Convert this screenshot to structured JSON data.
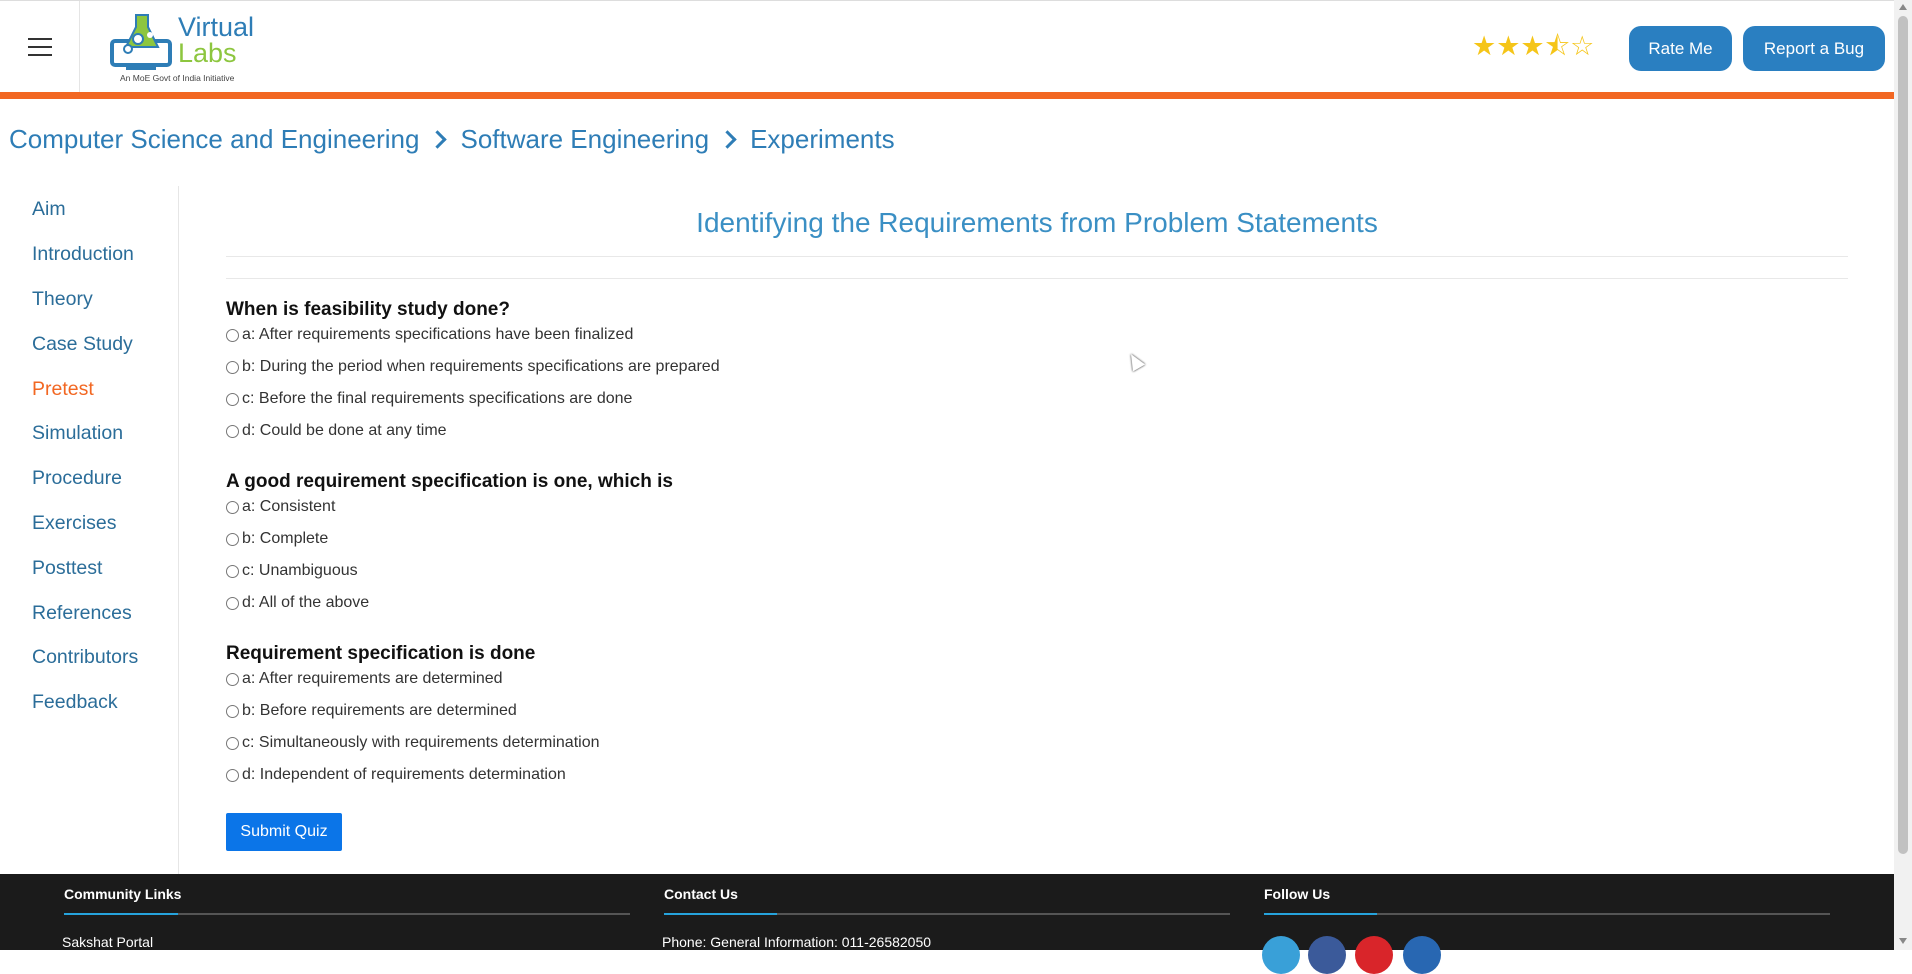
{
  "header": {
    "logo_line1": "Virtual",
    "logo_line2": "Labs",
    "logo_tagline": "An MoE Govt of India Initiative",
    "rating_stars": "★★★⯪☆",
    "rate_label": "Rate Me",
    "bug_label": "Report a Bug"
  },
  "breadcrumb": [
    "Computer Science and Engineering",
    "Software Engineering",
    "Experiments"
  ],
  "sidebar": {
    "items": [
      "Aim",
      "Introduction",
      "Theory",
      "Case Study",
      "Pretest",
      "Simulation",
      "Procedure",
      "Exercises",
      "Posttest",
      "References",
      "Contributors",
      "Feedback"
    ],
    "active": "Pretest"
  },
  "main": {
    "title": "Identifying the Requirements from Problem Statements",
    "questions": [
      {
        "text": "When is feasibility study done?",
        "options": [
          "a: After requirements specifications have been finalized",
          "b: During the period when requirements specifications are prepared",
          "c: Before the final requirements specifications are done",
          "d: Could be done at any time"
        ]
      },
      {
        "text": "A good requirement specification is one, which is",
        "options": [
          "a: Consistent",
          "b: Complete",
          "c: Unambiguous",
          "d: All of the above"
        ]
      },
      {
        "text": "Requirement specification is done",
        "options": [
          "a: After requirements are determined",
          "b: Before requirements are determined",
          "c: Simultaneously with requirements determination",
          "d: Independent of requirements determination"
        ]
      }
    ],
    "submit_label": "Submit Quiz"
  },
  "footer": {
    "community_title": "Community Links",
    "community_first": "Sakshat Portal",
    "contact_title": "Contact Us",
    "contact_first": "Phone: General Information: 011-26582050",
    "follow_title": "Follow Us"
  },
  "colors": {
    "accent_blue": "#2e7db6",
    "active_orange": "#f26722",
    "submit_blue": "#0b75e8",
    "footer_bg": "#1b1b1b"
  }
}
